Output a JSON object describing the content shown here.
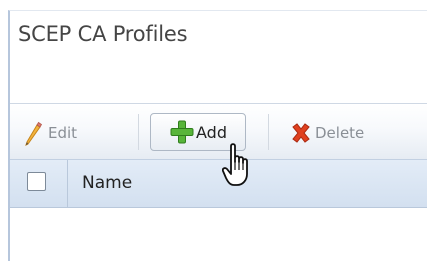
{
  "page": {
    "title": "SCEP CA Profiles"
  },
  "toolbar": {
    "edit_label": "Edit",
    "add_label": "Add",
    "delete_label": "Delete",
    "edit_icon": "pencil-icon",
    "add_icon": "plus-icon",
    "delete_icon": "x-icon"
  },
  "table": {
    "columns": [
      "Name"
    ],
    "select_all_checked": false
  },
  "colors": {
    "add_icon": "#4caf2e",
    "delete_icon": "#d9371f",
    "edit_icon": "#e9a92b",
    "header_bg": "#d8e4f2"
  }
}
